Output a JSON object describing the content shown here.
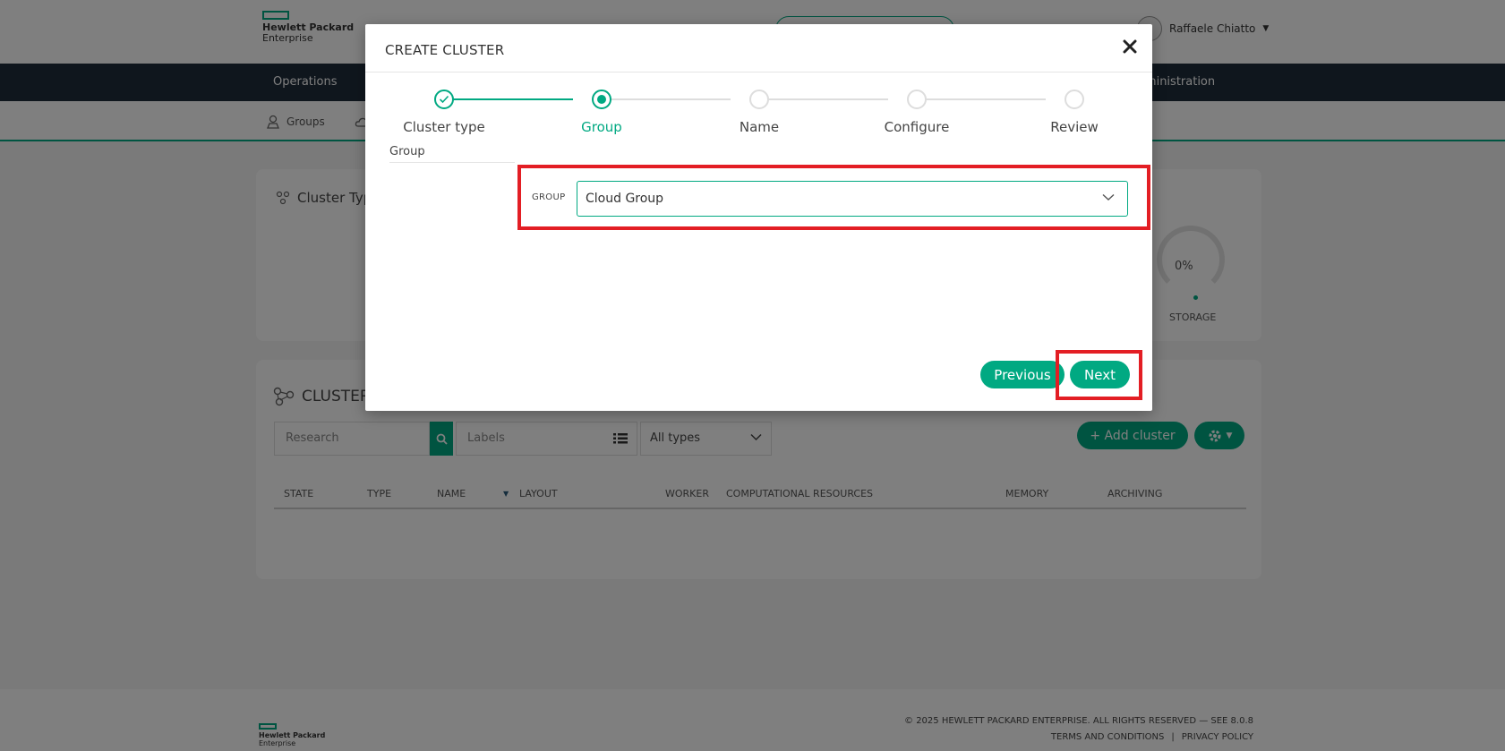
{
  "brand": {
    "line1": "Hewlett Packard",
    "line2": "Enterprise"
  },
  "user": {
    "name": "Raffaele Chiatto"
  },
  "nav": {
    "operations": "Operations",
    "administration": "Administration"
  },
  "subnav": {
    "groups": "Groups"
  },
  "cards": {
    "cluster_types_title": "Cluster Types",
    "storage_value": "0%",
    "storage_label": "STORAGE",
    "clusters_title": "CLUSTERS"
  },
  "filters": {
    "search_placeholder": "Research",
    "labels_placeholder": "Labels",
    "types_value": "All types",
    "add_cluster": "+ Add cluster"
  },
  "table": {
    "columns": [
      "STATE",
      "TYPE",
      "NAME",
      "LAYOUT",
      "WORKER",
      "COMPUTATIONAL RESOURCES",
      "MEMORY",
      "ARCHIVING"
    ]
  },
  "footer": {
    "copyright": "© 2025 HEWLETT PACKARD ENTERPRISE. ALL RIGHTS RESERVED — SEE 8.0.8",
    "terms": "TERMS AND CONDITIONS",
    "separator": "|",
    "privacy": "PRIVACY POLICY"
  },
  "modal": {
    "title": "CREATE CLUSTER",
    "steps": [
      {
        "label": "Cluster type",
        "state": "done"
      },
      {
        "label": "Group",
        "state": "active"
      },
      {
        "label": "Name",
        "state": "pending"
      },
      {
        "label": "Configure",
        "state": "pending"
      },
      {
        "label": "Review",
        "state": "pending"
      }
    ],
    "section_label": "Group",
    "group_field_label": "GROUP",
    "group_value": "Cloud Group",
    "previous_label": "Previous",
    "next_label": "Next"
  },
  "colors": {
    "accent": "#01a982",
    "navbar": "#1f2c3b",
    "highlight": "#e31e24"
  }
}
